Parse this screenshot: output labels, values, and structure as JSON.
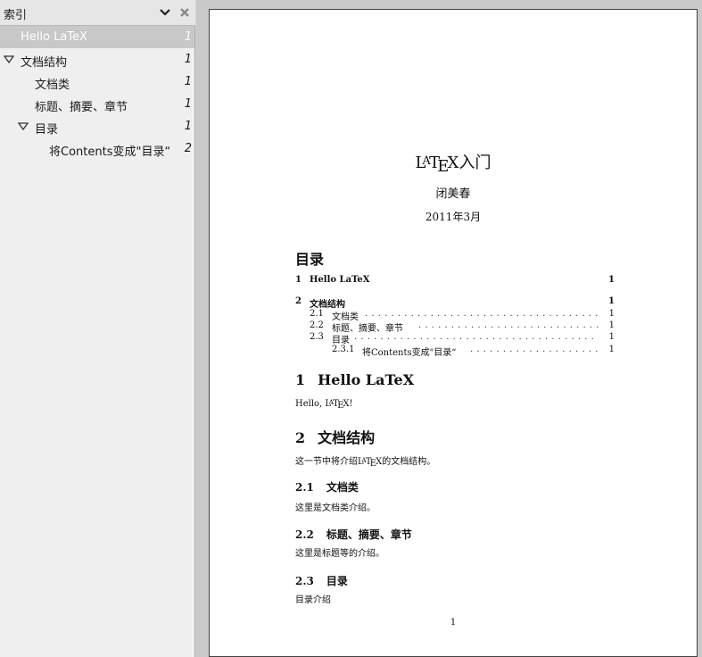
{
  "sidebar": {
    "title": "索引",
    "menu_icon": "chevron-down-icon",
    "close_icon": "close-icon",
    "items": [
      {
        "label": "Hello LaTeX",
        "page": "1",
        "selected": true,
        "expander": ""
      },
      {
        "label": "文档结构",
        "page": "1",
        "selected": false,
        "expander": "expanded"
      },
      {
        "label": "文档类",
        "page": "1",
        "selected": false,
        "expander": ""
      },
      {
        "label": "标题、摘要、章节",
        "page": "1",
        "selected": false,
        "expander": ""
      },
      {
        "label": "目录",
        "page": "1",
        "selected": false,
        "expander": "expanded"
      },
      {
        "label": "将Contents变成\"目录“",
        "page": "2",
        "selected": false,
        "expander": ""
      }
    ]
  },
  "document": {
    "title_logo": "LaTeX",
    "title_rest": "入门",
    "author": "闭美春",
    "date": "2011年3月",
    "toc_heading": "目录",
    "toc": [
      {
        "num": "1",
        "title": "Hello LaTeX",
        "page": "1"
      },
      {
        "num": "2",
        "title": "文档结构",
        "page": "1"
      },
      {
        "num": "2.1",
        "title": "文档类",
        "page": "1"
      },
      {
        "num": "2.2",
        "title": "标题、摘要、章节",
        "page": "1"
      },
      {
        "num": "2.3",
        "title": "目录",
        "page": "1"
      },
      {
        "num": "2.3.1",
        "title": "将Contents变成\"目录“",
        "page": "1"
      }
    ],
    "sec1": {
      "num": "1",
      "title": "Hello LaTeX",
      "body_before": "Hello, ",
      "body_logo": "LaTeX",
      "body_after": "!"
    },
    "sec2": {
      "num": "2",
      "title": "文档结构",
      "body_before": "这一节中将介绍",
      "body_logo": "LaTeX",
      "body_after": "的文档结构。"
    },
    "sec21": {
      "num": "2.1",
      "title": "文档类",
      "body": "这里是文档类介绍。"
    },
    "sec22": {
      "num": "2.2",
      "title": "标题、摘要、章节",
      "body": "这里是标题等的介绍。"
    },
    "sec23": {
      "num": "2.3",
      "title": "目录",
      "body": "目录介绍"
    },
    "page_number": "1"
  }
}
